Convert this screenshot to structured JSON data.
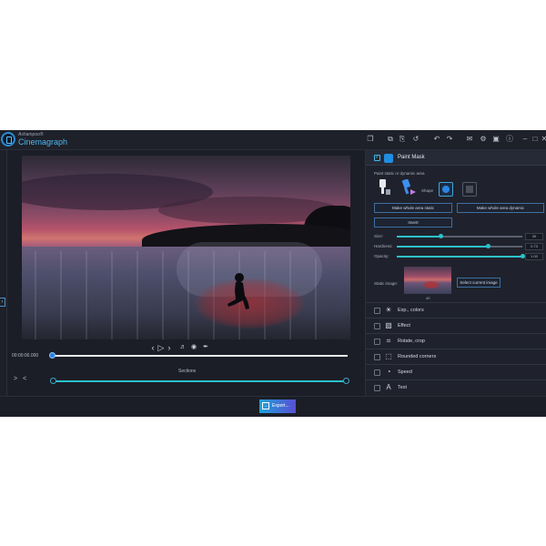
{
  "app": {
    "brand": "Ashampoo®",
    "name": "Cinemagraph"
  },
  "toolbar": {
    "icons": [
      "folder-icon",
      "copy-icon",
      "duplicate-icon",
      "reset-icon",
      "undo-icon",
      "redo-icon",
      "chat-icon",
      "settings-icon",
      "image-icon",
      "info-icon"
    ],
    "glyphs": [
      "❐",
      "⧉",
      "⎘",
      "↺",
      "↶",
      "↷",
      "✉",
      "⚙",
      "▣",
      "ⓘ"
    ]
  },
  "window": {
    "minimize": "–",
    "maximize": "□",
    "close": "✕"
  },
  "player": {
    "timecode": "00:00:00.000",
    "sections_label": "Sections",
    "sections_buttons": "> <",
    "controls": [
      "‹",
      "▷",
      "›",
      "🔈",
      "👁",
      "🖌"
    ]
  },
  "paint_mask": {
    "title": "Paint Mask",
    "checked": true,
    "subtitle": "Paint static or dynamic area",
    "shape_label": "Shape",
    "btn_static": "Make whole area static",
    "btn_dynamic": "Make whole area dynamic",
    "btn_invert": "Invert",
    "size_label": "Size:",
    "size_value": "30",
    "size_fraction": 0.35,
    "hardness_label": "Hardness:",
    "hardness_value": "0.73",
    "hardness_fraction": 0.73,
    "opacity_label": "Opacity:",
    "opacity_value": "1.00",
    "opacity_fraction": 1.0,
    "static_image_label": "Static image:",
    "static_image_index": "40",
    "select_button": "Select current image"
  },
  "sections": [
    {
      "label": "Exp., colors",
      "icon": "☀"
    },
    {
      "label": "Effect",
      "icon": "▧"
    },
    {
      "label": "Rotate, crop",
      "icon": "⌗"
    },
    {
      "label": "Rounded corners",
      "icon": "⬚"
    },
    {
      "label": "Speed",
      "icon": "◔"
    },
    {
      "label": "Text",
      "icon": "A"
    }
  ],
  "export": {
    "label": "Export..."
  },
  "colors": {
    "accent": "#2cc1c9",
    "brand": "#4fb6f0",
    "export_start": "#1fa1d8",
    "export_end": "#5a4fd6"
  }
}
